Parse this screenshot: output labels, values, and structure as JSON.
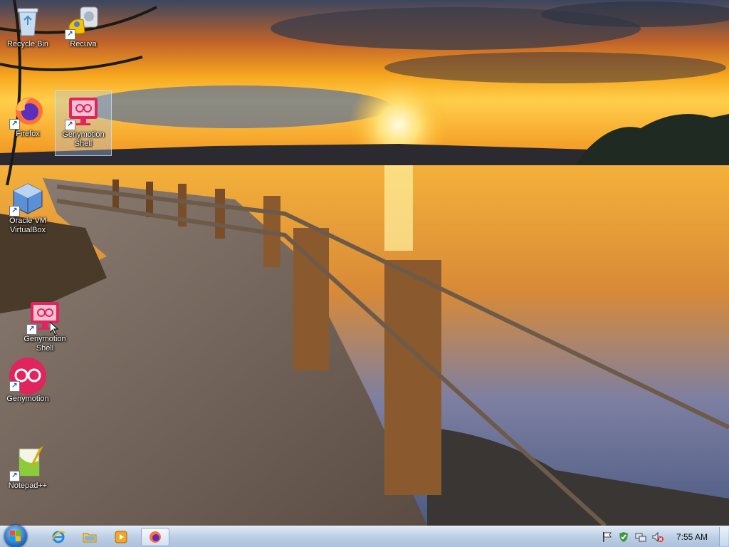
{
  "desktop": {
    "wallpaper": "sunset-lake-boardwalk",
    "icons": [
      {
        "label": "Recycle Bin",
        "icon": "recycle-bin-icon"
      },
      {
        "label": "Recuva",
        "icon": "recuva-icon"
      },
      {
        "label": "Firefox",
        "icon": "firefox-icon"
      },
      {
        "label": "Genymotion Shell",
        "icon": "genymotion-shell-icon",
        "selected": true
      },
      {
        "label": "Oracle VM VirtualBox",
        "icon": "virtualbox-icon"
      },
      {
        "label": "Genymotion Shell",
        "icon": "genymotion-shell-icon"
      },
      {
        "label": "Genymotion",
        "icon": "genymotion-icon"
      },
      {
        "label": "Notepad++",
        "icon": "notepad-plus-plus-icon"
      }
    ]
  },
  "taskbar": {
    "start": "start-button",
    "pinned": [
      {
        "icon": "internet-explorer-icon"
      },
      {
        "icon": "file-explorer-icon"
      },
      {
        "icon": "media-player-icon"
      },
      {
        "icon": "firefox-icon",
        "active": true
      }
    ],
    "tray": [
      {
        "icon": "action-center-flag-icon"
      },
      {
        "icon": "security-shield-icon"
      },
      {
        "icon": "network-icon"
      },
      {
        "icon": "volume-muted-icon"
      }
    ],
    "clock": "7:55 AM"
  },
  "colors": {
    "taskbar": "#bccfe6",
    "genymotion": "#e0245e"
  }
}
